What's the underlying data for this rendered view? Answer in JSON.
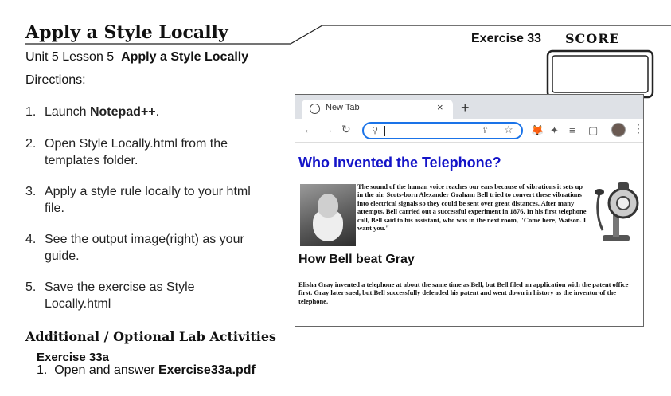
{
  "header": {
    "title": "Apply a Style Locally",
    "exercise": "Exercise 33",
    "score": "SCORE"
  },
  "lesson": {
    "unit": "Unit 5 Lesson 5",
    "name": "Apply a Style Locally",
    "directions": "Directions:"
  },
  "steps": [
    {
      "num": "1.",
      "pre": "Launch ",
      "bold": "Notepad++",
      "post": "."
    },
    {
      "num": "2.",
      "pre": "Open Style Locally.html from the templates folder.",
      "bold": "",
      "post": ""
    },
    {
      "num": "3.",
      "pre": "Apply a style rule locally to your html file.",
      "bold": "",
      "post": ""
    },
    {
      "num": "4.",
      "pre": "See the output image(right) as your guide.",
      "bold": "",
      "post": ""
    },
    {
      "num": "5.",
      "pre": "Save the exercise as Style Locally.html",
      "bold": "",
      "post": ""
    }
  ],
  "additional": {
    "title": "Additional / Optional Lab Activities",
    "exercise": "Exercise 33a",
    "step_num": "1.",
    "step_pre": "Open and answer ",
    "step_bold": "Exercise33a.pdf"
  },
  "browser": {
    "tab_label": "New Tab",
    "tab_close": "×",
    "new_tab": "+",
    "icons": [
      "globe-icon",
      "back-icon",
      "forward-icon",
      "reload-icon",
      "search-icon",
      "share-icon",
      "star-icon",
      "fox-extension-icon",
      "puzzle-extension-icon",
      "playlist-icon",
      "sidebar-icon",
      "avatar",
      "menu-icon"
    ],
    "page": {
      "heading": "Who Invented the Telephone?",
      "paragraph1": "The sound of the human voice reaches our ears because of vibrations it sets up in the air. Scots-born Alexander Graham Bell tried to convert these vibrations into electrical signals so they could be sent over great distances. After many attempts, Bell carried out a successful experiment in 1876. In his first telephone call, Bell said to his assistant, who was in the next room, \"Come here, Watson. I want you.\"",
      "heading2": "How Bell beat Gray",
      "paragraph2": "Elisha Gray invented a telephone at about the same time as Bell, but Bell filed an application with the patent office first. Gray later sued, but Bell successfully defended his patent and went down in history as the inventor of the telephone."
    }
  },
  "colors": {
    "heading_blue": "#1414c8",
    "omnibox_focus": "#1a73e8",
    "tabbar": "#dee1e6"
  }
}
